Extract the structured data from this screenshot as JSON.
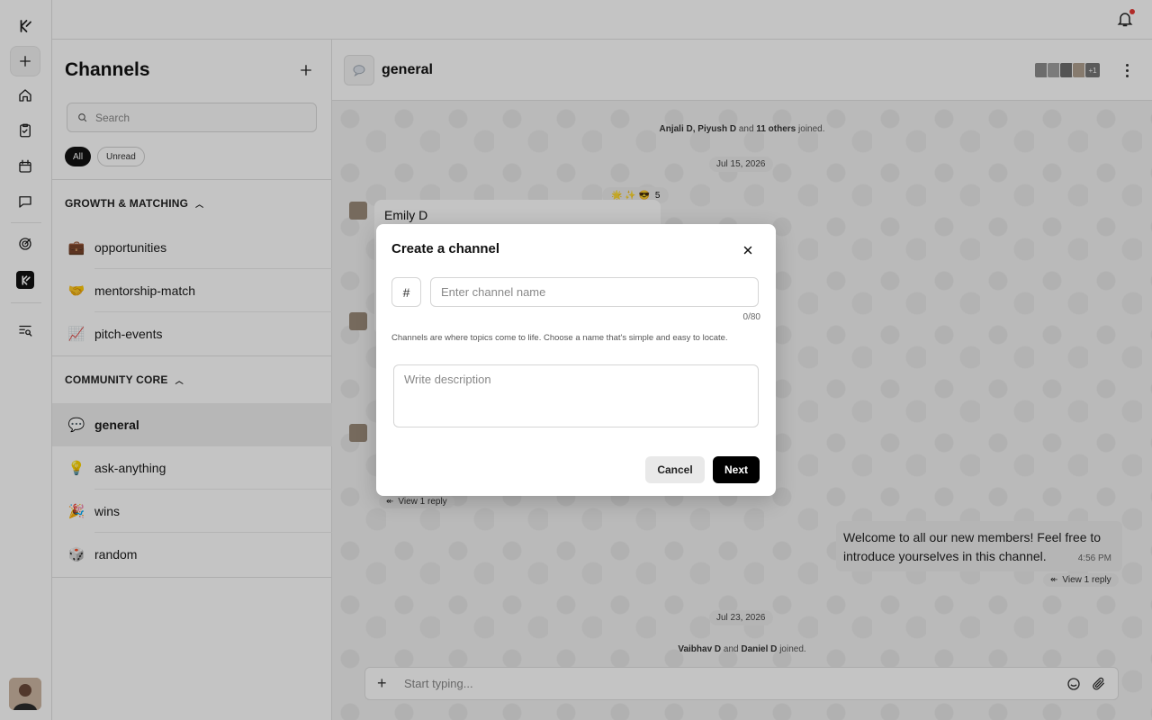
{
  "sidebar": {
    "title": "Channels",
    "search_placeholder": "Search",
    "filters": {
      "all": "All",
      "unread": "Unread"
    },
    "groups": [
      {
        "label": "GROWTH & MATCHING",
        "channels": [
          {
            "emoji": "💼",
            "name": "opportunities"
          },
          {
            "emoji": "🤝",
            "name": "mentorship-match"
          },
          {
            "emoji": "📈",
            "name": "pitch-events"
          }
        ]
      },
      {
        "label": "COMMUNITY CORE",
        "channels": [
          {
            "emoji": "💬",
            "name": "general"
          },
          {
            "emoji": "💡",
            "name": "ask-anything"
          },
          {
            "emoji": "🎉",
            "name": "wins"
          },
          {
            "emoji": "🎲",
            "name": "random"
          }
        ]
      }
    ]
  },
  "chat": {
    "channel_name": "general",
    "members_more": "+1",
    "joined_1": {
      "names": "Anjali D, Piyush D",
      "mid": "and",
      "others": "11 others",
      "tail": "joined."
    },
    "date_1": "Jul 15, 2026",
    "reactions": {
      "emojis": "🌟 ✨ 😎",
      "count": "5"
    },
    "message_1_author": "Emily D",
    "view_reply": "View 1 reply",
    "bubble_text": "Welcome to all our new members! Feel free to introduce yourselves in this channel.",
    "bubble_time": "4:56 PM",
    "date_2": "Jul 23, 2026",
    "joined_2": {
      "a": "Vaibhav D",
      "mid": "and",
      "b": "Daniel D",
      "tail": "joined."
    },
    "composer_placeholder": "Start typing..."
  },
  "modal": {
    "title": "Create a channel",
    "hash": "#",
    "name_placeholder": "Enter channel name",
    "counter": "0/80",
    "helper": "Channels are where topics come to life. Choose a name that's simple and easy to locate.",
    "description_placeholder": "Write description",
    "cancel": "Cancel",
    "next": "Next"
  }
}
